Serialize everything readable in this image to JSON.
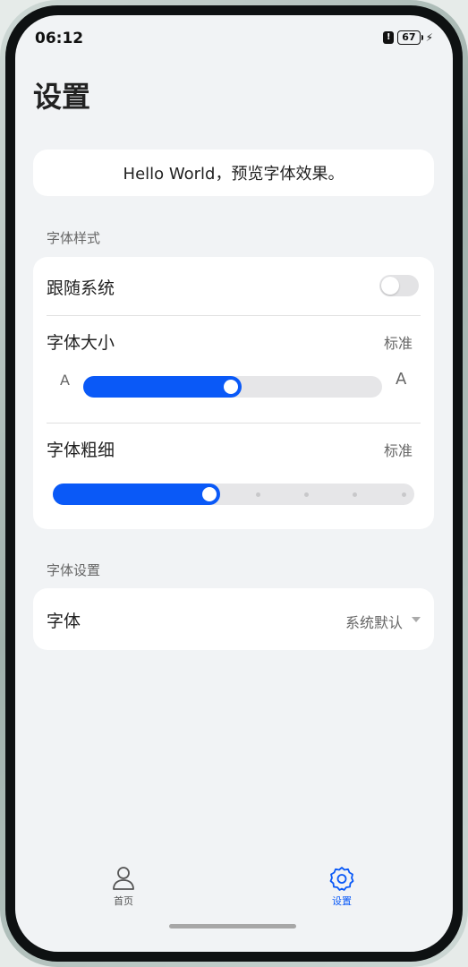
{
  "status_bar": {
    "time": "06:12",
    "alert_glyph": "!",
    "battery_level": "67",
    "icons": [
      "alert-icon",
      "battery-icon",
      "charging-bolt-icon"
    ]
  },
  "page": {
    "title": "设置"
  },
  "preview": {
    "text": "Hello World，预览字体效果。"
  },
  "font_style_section": {
    "label": "字体样式",
    "follow_system": {
      "label": "跟随系统",
      "enabled": false
    },
    "font_size": {
      "label": "字体大小",
      "value": "标准",
      "min_glyph": "A",
      "max_glyph": "A",
      "level_fraction": 0.53
    },
    "font_weight": {
      "label": "字体粗细",
      "value": "标准",
      "steps": 8,
      "selected_step": 3
    }
  },
  "font_settings_section": {
    "label": "字体设置",
    "font": {
      "label": "字体",
      "value": "系统默认"
    }
  },
  "tabbar": {
    "tabs": [
      {
        "label": "首页",
        "icon": "person-icon",
        "active": false
      },
      {
        "label": "设置",
        "icon": "gear-icon",
        "active": true
      }
    ],
    "inactive_color": "#555555",
    "active_color": "#0a59f7"
  },
  "colors": {
    "accent": "#0a59f7",
    "background": "#f1f3f5",
    "card": "#ffffff"
  }
}
